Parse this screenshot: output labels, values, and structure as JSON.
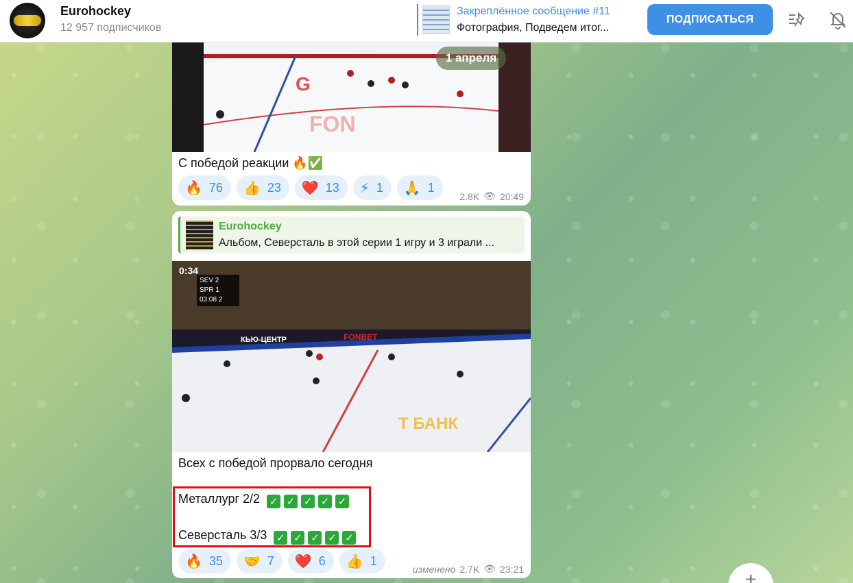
{
  "channel": {
    "title": "Eurohockey",
    "subscribers": "12 957 подписчиков"
  },
  "pinned": {
    "title": "Закреплённое сообщение #11",
    "text": "Фотография, Подведем итог..."
  },
  "header": {
    "subscribe_label": "ПОДПИСАТЬСЯ"
  },
  "date_chip": "1 апреля",
  "messages": [
    {
      "caption": "С победой реакции 🔥✅",
      "reactions": [
        {
          "emoji": "🔥",
          "count": "76"
        },
        {
          "emoji": "👍",
          "count": "23"
        },
        {
          "emoji": "❤️",
          "count": "13"
        },
        {
          "emoji": "⚡",
          "count": "1"
        },
        {
          "emoji": "🙏",
          "count": "1"
        }
      ],
      "views": "2.8K",
      "time": "20:49"
    },
    {
      "forward": {
        "name": "Eurohockey",
        "text": "Альбом, Северсталь в этой серии 1 игру и 3 играли ..."
      },
      "video_time": "0:34",
      "score": {
        "team1": "SEV",
        "score1": "2",
        "team2": "SPR",
        "score2": "1",
        "clock": "03:08",
        "period": "2"
      },
      "caption": "Всех с победой прорвало сегодня",
      "line1": "Металлург 2/2",
      "line2": "Северсталь 3/3",
      "checks_line1": 5,
      "checks_line2": 5,
      "reactions": [
        {
          "emoji": "🔥",
          "count": "35"
        },
        {
          "emoji": "🤝",
          "count": "7"
        },
        {
          "emoji": "❤️",
          "count": "6"
        },
        {
          "emoji": "👍",
          "count": "1"
        }
      ],
      "edited_label": "изменено",
      "views": "2.7K",
      "time": "23:21"
    }
  ],
  "colors": {
    "accent": "#3e8fe6",
    "forward_green": "#4eaa3a",
    "highlight_red": "#e01010"
  }
}
